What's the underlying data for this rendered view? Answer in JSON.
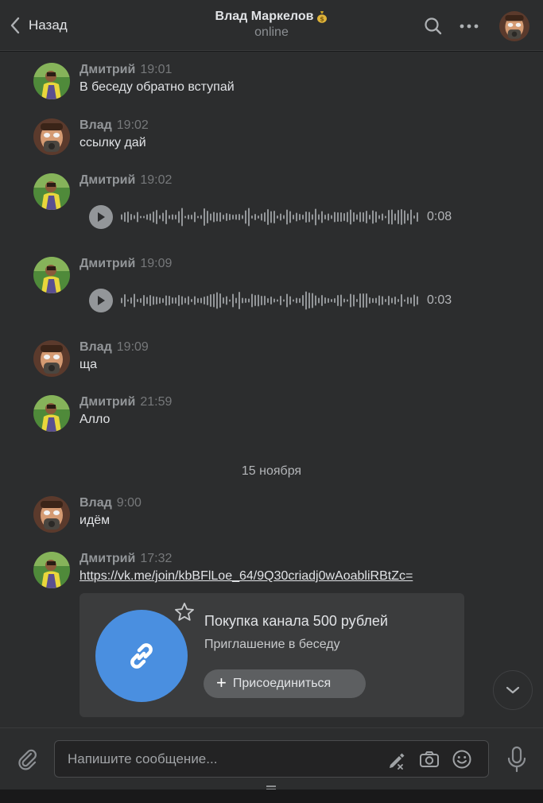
{
  "header": {
    "back_label": "Назад",
    "title": "Влад Маркелов",
    "title_badge_icon": "money-bag-icon",
    "status": "online"
  },
  "messages": [
    {
      "author": "Дмитрий",
      "time": "19:01",
      "type": "text",
      "text": "В беседу обратно вступай"
    },
    {
      "author": "Влад",
      "time": "19:02",
      "type": "text",
      "text": "ссылку дай"
    },
    {
      "author": "Дмитрий",
      "time": "19:02",
      "type": "voice",
      "duration": "0:08"
    },
    {
      "author": "Дмитрий",
      "time": "19:09",
      "type": "voice",
      "duration": "0:03"
    },
    {
      "author": "Влад",
      "time": "19:09",
      "type": "text",
      "text": "ща"
    },
    {
      "author": "Дмитрий",
      "time": "21:59",
      "type": "text",
      "text": "Алло"
    },
    {
      "author": "Влад",
      "time": "9:00",
      "type": "text",
      "text": "идём"
    },
    {
      "author": "Дмитрий",
      "time": "17:32",
      "type": "link",
      "text": "https://vk.me/join/kbBFlLoe_64/9Q30criadj0wAoabliRBtZc="
    }
  ],
  "date_separator": "15 ноября",
  "invite_card": {
    "title": "Покупка канала 500 рублей",
    "subtitle": "Приглашение в беседу",
    "join_label": "Присоединиться"
  },
  "composer": {
    "placeholder": "Напишите сообщение...",
    "value": ""
  },
  "colors": {
    "background": "#2c2d2e",
    "accent": "#4a8fe0",
    "text": "#e1e3e6",
    "muted": "#939699"
  }
}
